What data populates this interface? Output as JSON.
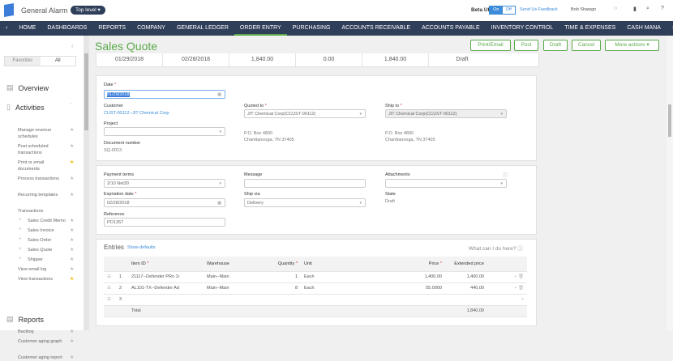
{
  "header": {
    "company": "General Alarm",
    "entity": "Top level",
    "beta_label": "Beta UI",
    "beta_on": "On",
    "beta_off": "Off",
    "feedback": "Send Us Feedback",
    "user": "Bob Shawgo"
  },
  "nav": {
    "items": [
      "HOME",
      "DASHBOARDS",
      "REPORTS",
      "COMPANY",
      "GENERAL LEDGER",
      "ORDER ENTRY",
      "PURCHASING",
      "ACCOUNTS RECEIVABLE",
      "ACCOUNTS PAYABLE",
      "INVENTORY CONTROL",
      "TIME & EXPENSES",
      "CASH MANA"
    ],
    "active": "ORDER ENTRY"
  },
  "sidebar": {
    "tabs": [
      "Favorites",
      "All"
    ],
    "overview": "Overview",
    "activities": "Activities",
    "activity_items": [
      {
        "label": "Manage revenue schedules",
        "fav": false
      },
      {
        "label": "Post scheduled transactions",
        "fav": false
      },
      {
        "label": "Print or email documents",
        "fav": true
      },
      {
        "label": "Process transactions",
        "fav": false
      },
      {
        "label": "Recurring templates",
        "fav": false
      }
    ],
    "transactions": "Transactions",
    "transaction_items": [
      {
        "label": "Sales Credit Memo",
        "fav": false
      },
      {
        "label": "Sales Invoice",
        "fav": false
      },
      {
        "label": "Sales Order",
        "fav": false
      },
      {
        "label": "Sales Quote",
        "fav": false
      },
      {
        "label": "Shipper",
        "fav": false
      }
    ],
    "other_items": [
      {
        "label": "View email log",
        "fav": false
      },
      {
        "label": "View transactions",
        "fav": true
      }
    ],
    "reports": "Reports",
    "report_items": [
      {
        "label": "Backlog",
        "fav": false
      },
      {
        "label": "Customer aging graph",
        "fav": false
      },
      {
        "label": "Customer aging report",
        "fav": false
      }
    ]
  },
  "page": {
    "title": "Sales Quote",
    "buttons": {
      "print": "Print/Email",
      "post": "Post",
      "draft": "Draft",
      "cancel": "Cancel",
      "more": "More actions"
    }
  },
  "summary": [
    "01/29/2018",
    "02/28/2018",
    "1,840.00",
    "0.00",
    "1,840.00",
    "Draft"
  ],
  "form": {
    "date_label": "Date",
    "date": "01/29/2018",
    "customer_label": "Customer",
    "customer": "CUST-00112--JIT Chemical Corp",
    "project_label": "Project",
    "project": "",
    "docnum_label": "Document number",
    "docnum": "SQ-0013",
    "quoted_label": "Quoted to",
    "quoted": "JIT Chemical Corp(CCUST-00112)",
    "quoted_addr1": "P.O. Box 4800",
    "quoted_addr2": "Chanttanooga, TN 37405",
    "shipto_label": "Ship to",
    "shipto": "JIT Chemical Corp(CCUST-00112)",
    "ship_addr1": "P.O. Box 4800",
    "ship_addr2": "Chanttanooga, TN 37405",
    "terms_label": "Payment terms",
    "terms": "2/10 Net30",
    "exp_label": "Expiration date",
    "exp": "02/28/2018",
    "ref_label": "Reference",
    "ref": "PO1357",
    "message_label": "Message",
    "message": "",
    "shipvia_label": "Ship via",
    "shipvia": "Delivery",
    "attach_label": "Attachments",
    "state_label": "State",
    "state": "Draft"
  },
  "entries": {
    "title": "Entries",
    "show_defaults": "Show defaults",
    "help": "What can I do here?",
    "headers": [
      "Item ID",
      "Warehouse",
      "Quantity",
      "Unit",
      "Price",
      "Extended price"
    ],
    "rows": [
      {
        "n": "1",
        "item": "21117--Defender PRo 1r",
        "wh": "Main--Main",
        "qty": "1",
        "unit": "Each",
        "price": "1,400.00",
        "ext": "1,400.00"
      },
      {
        "n": "2",
        "item": "AL101-TX--Defender Ad",
        "wh": "Main--Main",
        "qty": "8",
        "unit": "Each",
        "price": "55.0000",
        "ext": "440.00"
      },
      {
        "n": "3",
        "item": "",
        "wh": "",
        "qty": "",
        "unit": "",
        "price": "",
        "ext": ""
      }
    ],
    "total_label": "Total",
    "total": "1,840.00"
  }
}
